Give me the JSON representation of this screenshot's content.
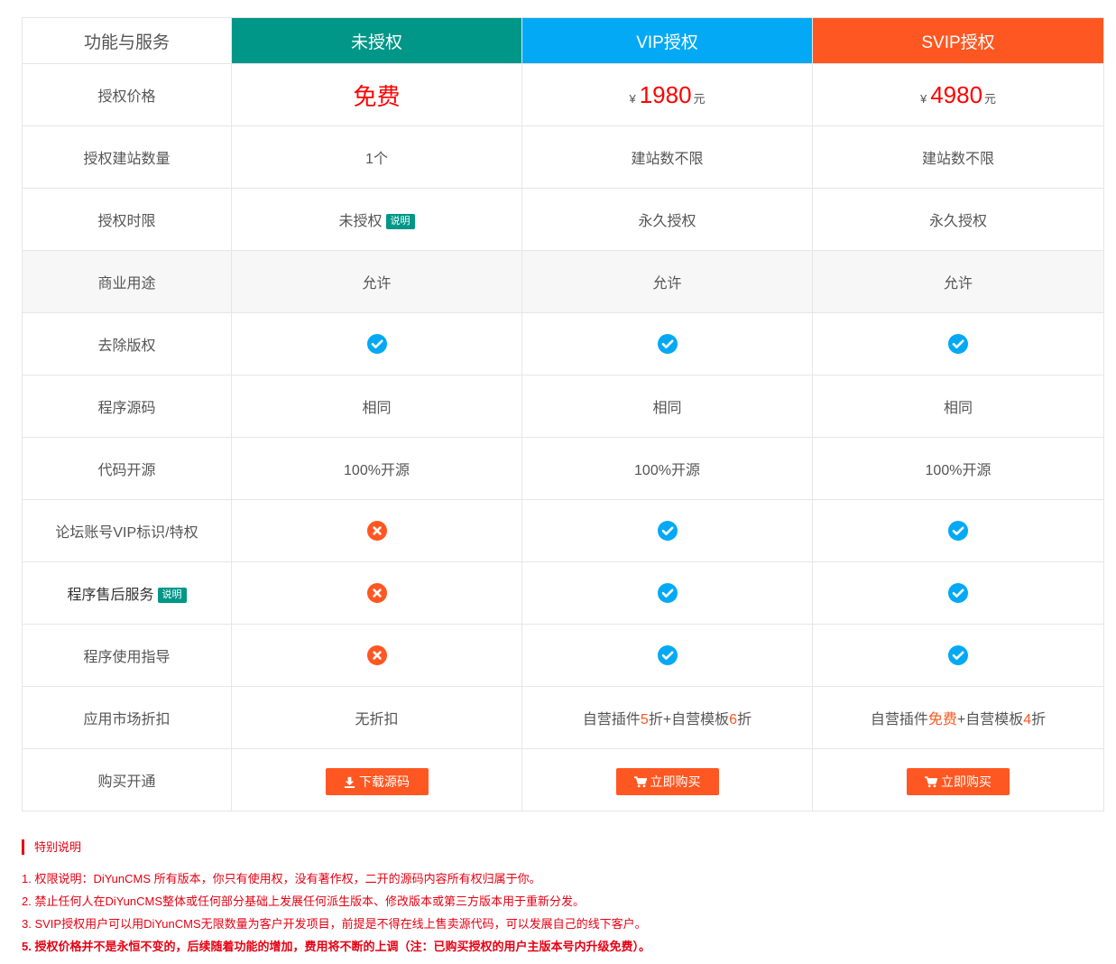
{
  "table": {
    "headers": [
      "功能与服务",
      "未授权",
      "VIP授权",
      "SVIP授权"
    ],
    "price": {
      "label": "授权价格",
      "free": "免费",
      "currency": "¥",
      "vip": "1980",
      "svip": "4980",
      "unit": "元"
    },
    "sites": {
      "label": "授权建站数量",
      "free": "1个",
      "vip": "建站数不限",
      "svip": "建站数不限"
    },
    "term": {
      "label": "授权时限",
      "free": "未授权",
      "free_badge": "说明",
      "vip": "永久授权",
      "svip": "永久授权"
    },
    "commercial": {
      "label": "商业用途",
      "free": "允许",
      "vip": "允许",
      "svip": "允许"
    },
    "copyright": {
      "label": "去除版权",
      "free": "check",
      "vip": "check",
      "svip": "check"
    },
    "source": {
      "label": "程序源码",
      "free": "相同",
      "vip": "相同",
      "svip": "相同"
    },
    "opensource": {
      "label": "代码开源",
      "free": "100%开源",
      "vip": "100%开源",
      "svip": "100%开源"
    },
    "forum": {
      "label": "论坛账号VIP标识/特权",
      "free": "cross",
      "vip": "check",
      "svip": "check"
    },
    "aftersales": {
      "label": "程序售后服务",
      "badge": "说明",
      "free": "cross",
      "vip": "check",
      "svip": "check"
    },
    "guide": {
      "label": "程序使用指导",
      "free": "cross",
      "vip": "check",
      "svip": "check"
    },
    "market": {
      "label": "应用市场折扣",
      "free": "无折扣",
      "vip": {
        "a": "自营插件",
        "b": "5",
        "c": "折+自营模板",
        "d": "6",
        "e": "折"
      },
      "svip": {
        "a": "自营插件",
        "b": "免费",
        "c": "+自营模板",
        "d": "4",
        "e": "折"
      }
    },
    "buy": {
      "label": "购买开通",
      "free": "下载源码",
      "vip": "立即购买",
      "svip": "立即购买"
    }
  },
  "notes": {
    "title": "特别说明",
    "items": [
      "1. 权限说明：DiYunCMS 所有版本，你只有使用权，没有著作权，二开的源码内容所有权归属于你。",
      "2. 禁止任何人在DiYunCMS整体或任何部分基础上发展任何派生版本、修改版本或第三方版本用于重新分发。",
      "3. SVIP授权用户可以用DiYunCMS无限数量为客户开发项目，前提是不得在线上售卖源代码，可以发展自己的线下客户。",
      "5. 授权价格并不是永恒不变的，后续随着功能的增加，费用将不断的上调（注：已购买授权的用户主版本号内升级免费）。"
    ]
  },
  "colors": {
    "free": "#009688",
    "vip": "#03a9f4",
    "svip": "#ff5722",
    "check": "#03a9f4",
    "cross": "#ff5722",
    "price": "#ff0000",
    "notes": "#e60012"
  }
}
